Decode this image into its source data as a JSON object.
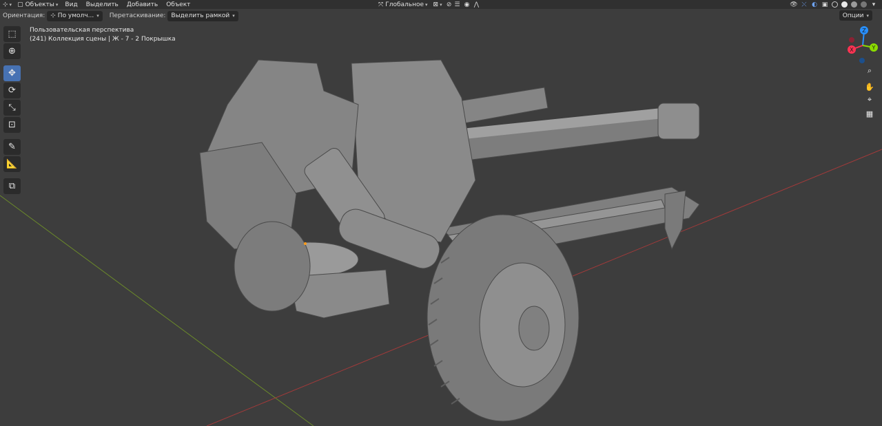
{
  "header": {
    "mode_label": "Объекты",
    "menus": [
      "Вид",
      "Выделить",
      "Добавить",
      "Объект"
    ],
    "transform_orientation": "Глобальное"
  },
  "tool_header": {
    "orientation_label": "Ориентация:",
    "orientation_value": "По умолч...",
    "drag_label": "Перетаскивание:",
    "drag_value": "Выделить рамкой",
    "options_label": "Опции"
  },
  "viewport": {
    "view_name": "Пользовательская перспектива",
    "collection_info": "(241) Коллекция сцены | Ж - 7 - 2 Покрышка"
  },
  "gizmo": {
    "x": "X",
    "y": "Y",
    "z": "Z"
  },
  "colors": {
    "accent": "#4772b3",
    "x_axis": "#ff3352",
    "y_axis": "#8bdc00",
    "z_axis": "#2890ff",
    "grid_x_line": "#a33a3a",
    "grid_y_line": "#6b8a2a",
    "model": "#8c8c8c"
  },
  "toolbar_icons": [
    "select-box-icon",
    "cursor-icon",
    "move-icon",
    "rotate-icon",
    "scale-icon",
    "transform-icon",
    "annotate-icon",
    "measure-icon",
    "add-cube-icon"
  ]
}
